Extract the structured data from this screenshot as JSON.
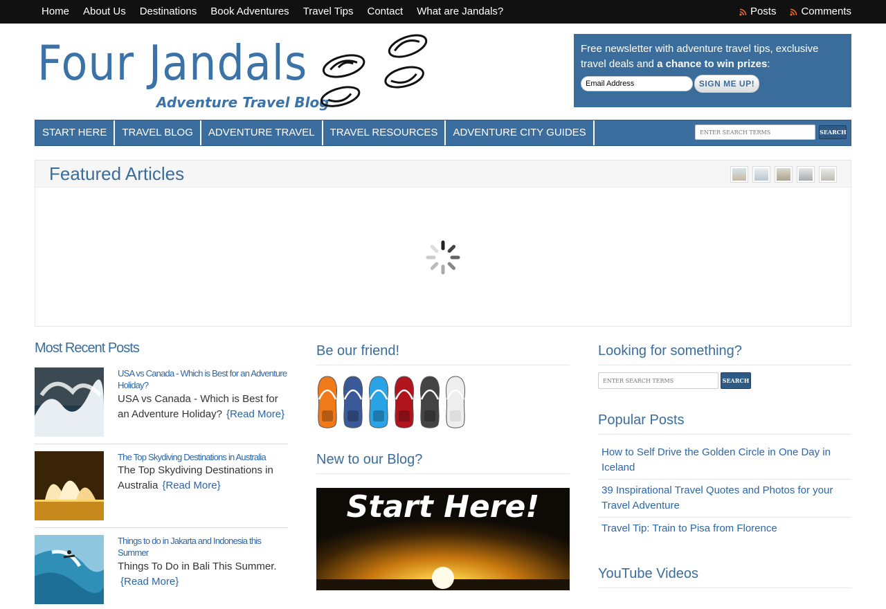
{
  "topnav": {
    "items": [
      "Home",
      "About Us",
      "Destinations",
      "Book Adventures",
      "Travel Tips",
      "Contact",
      "What are Jandals?"
    ],
    "feeds": [
      "Posts",
      "Comments"
    ]
  },
  "logo": {
    "title": "Four Jandals",
    "subtitle": "Adventure Travel Blog"
  },
  "newsletter": {
    "text_prefix": "Free newsletter with adventure travel tips, exclusive travel deals and ",
    "text_bold": "a chance to win prizes",
    "text_suffix": ":",
    "email_value": "Email Address",
    "button": "SIGN ME UP!"
  },
  "mainnav": {
    "items": [
      "START HERE",
      "TRAVEL BLOG",
      "ADVENTURE TRAVEL",
      "TRAVEL RESOURCES",
      "ADVENTURE CITY GUIDES"
    ],
    "search_placeholder": "ENTER SEARCH TERMS",
    "search_button": "SEARCH"
  },
  "featured": {
    "title": "Featured Articles"
  },
  "recent": {
    "title": "Most Recent Posts",
    "posts": [
      {
        "link": "USA vs Canada - Which is Best for an Adventure Holiday?",
        "excerpt": "USA vs Canada - Which is Best for an Adventure Holiday?",
        "more": "{Read More}"
      },
      {
        "link": "The Top Skydiving Destinations in Australia",
        "excerpt": "The Top Skydiving Destinations in Australia",
        "more": "{Read More}"
      },
      {
        "link": "Things to do in Jakarta and Indonesia this Summer",
        "excerpt": "Things To Do in Bali This Summer.",
        "more": "{Read More}"
      }
    ]
  },
  "friend": {
    "title": "Be our friend!",
    "socials": [
      "rss-icon",
      "facebook-icon",
      "twitter-icon",
      "pinterest-icon",
      "google-plus-icon",
      "youtube-icon"
    ],
    "colors": [
      "#f07a1a",
      "#3b5998",
      "#2aa3e6",
      "#b0151e",
      "#444444",
      "#eeeeee"
    ]
  },
  "newblog": {
    "title": "New to our Blog?",
    "banner_text": "Start Here!"
  },
  "side": {
    "search_title": "Looking for something?",
    "search_placeholder": "ENTER SEARCH TERMS",
    "search_button": "SEARCH",
    "popular_title": "Popular Posts",
    "popular": [
      "How to Self Drive the Golden Circle in One Day in Iceland",
      "39 Inspirational Travel Quotes and Photos for your Travel Adventure",
      "Travel Tip: Train to Pisa from Florence"
    ],
    "youtube_title": "YouTube Videos"
  },
  "colors": {
    "brand_blue": "#3a6d9c",
    "link_blue": "#2a66a8",
    "topbar": "#111111"
  }
}
